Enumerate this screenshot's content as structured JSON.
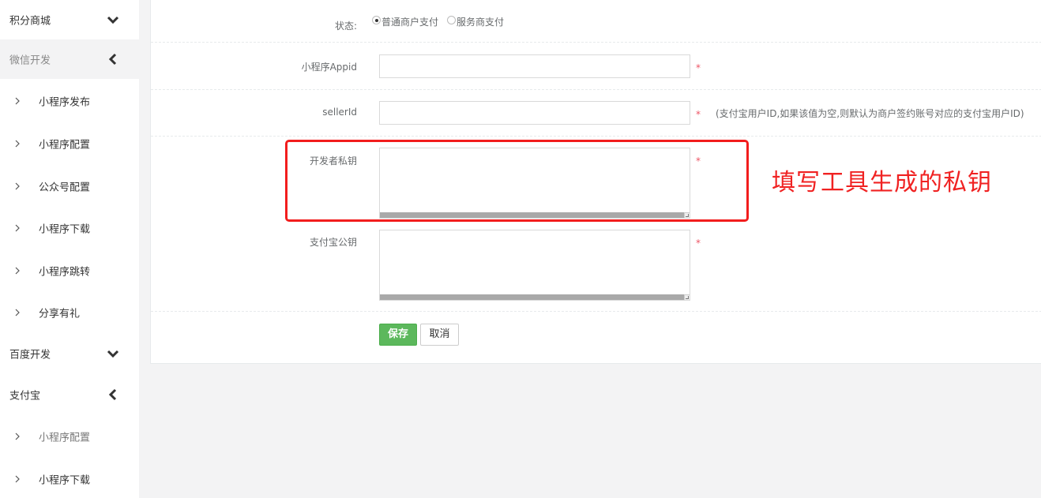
{
  "sidebar": {
    "items": [
      {
        "label": "积分商城",
        "chevron": "chevron-down-icon"
      },
      {
        "label": "微信开发",
        "chevron": "chevron-left-icon"
      },
      {
        "label": "小程序发布"
      },
      {
        "label": "小程序配置"
      },
      {
        "label": "公众号配置"
      },
      {
        "label": "小程序下载"
      },
      {
        "label": "小程序跳转"
      },
      {
        "label": "分享有礼"
      },
      {
        "label": "百度开发",
        "chevron": "chevron-down-icon"
      },
      {
        "label": "支付宝",
        "chevron": "chevron-left-icon"
      },
      {
        "label": "小程序配置"
      },
      {
        "label": "小程序下载"
      }
    ]
  },
  "form": {
    "status": {
      "label": "状态:",
      "options": [
        "普通商户支付",
        "服务商支付"
      ],
      "selected": "普通商户支付"
    },
    "appid": {
      "label": "小程序Appid",
      "value": "",
      "required": "*"
    },
    "sellerid": {
      "label": "sellerId",
      "value": "",
      "required": "*",
      "hint": "(支付宝用户ID,如果该值为空,则默认为商户签约账号对应的支付宝用户ID)"
    },
    "private_key": {
      "label": "开发者私钥",
      "value": "",
      "required": "*"
    },
    "public_key": {
      "label": "支付宝公钥",
      "value": "",
      "required": "*"
    },
    "save_label": "保存",
    "cancel_label": "取消"
  },
  "annotation": {
    "text": "填写工具生成的私钥",
    "color": "#f21d1d"
  },
  "colors": {
    "save_button": "#5cb85c",
    "required_mark": "#ed5565"
  }
}
